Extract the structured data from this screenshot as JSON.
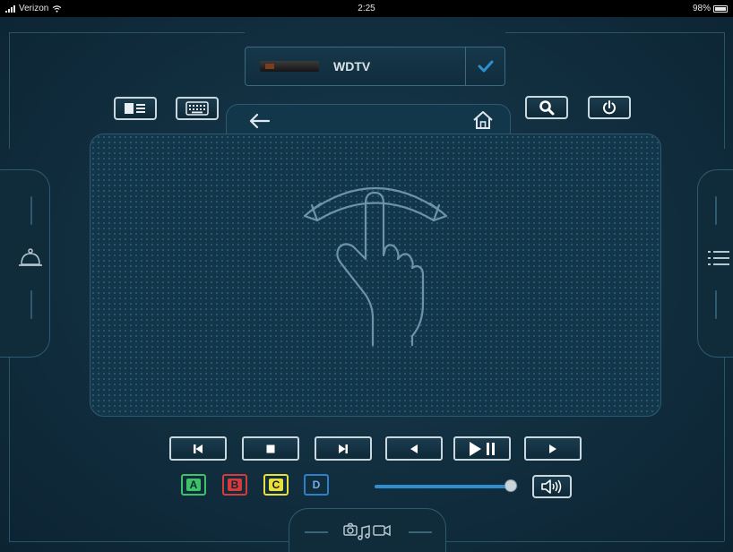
{
  "status_bar": {
    "carrier": "Verizon",
    "time": "2:25",
    "battery": "98%"
  },
  "device_selector": {
    "name": "WDTV"
  },
  "top_buttons": [
    {
      "name": "library-view-button",
      "icon": "panel-list-icon"
    },
    {
      "name": "keyboard-button",
      "icon": "keyboard-icon"
    },
    {
      "name": "search-button",
      "icon": "search-icon"
    },
    {
      "name": "power-button",
      "icon": "power-icon"
    }
  ],
  "touchpad": {
    "back_icon": "arrow-left-icon",
    "home_icon": "home-icon",
    "gesture_icon": "swipe-hand-icon"
  },
  "side": {
    "left_icon": "bell-icon",
    "right_icon": "list-icon"
  },
  "transport": [
    {
      "name": "previous-track-button",
      "icon": "skip-previous-icon"
    },
    {
      "name": "stop-button",
      "icon": "stop-icon"
    },
    {
      "name": "next-track-button",
      "icon": "skip-next-icon"
    },
    {
      "name": "rewind-button",
      "icon": "rewind-icon"
    },
    {
      "name": "play-pause-button",
      "icon": "play-pause-icon"
    },
    {
      "name": "forward-button",
      "icon": "forward-icon"
    }
  ],
  "color_keys": [
    {
      "label": "A",
      "color": "#3ec265"
    },
    {
      "label": "B",
      "color": "#d63a3a"
    },
    {
      "label": "C",
      "color": "#e8df3a"
    },
    {
      "label": "D",
      "color": "#2f7fc8"
    }
  ],
  "volume": {
    "level": 0.95,
    "icon": "speaker-icon"
  },
  "bottom": {
    "icon": "media-sources-icon"
  },
  "colors": {
    "accent": "#2d8fd0",
    "background": "#123041",
    "button_border": "#c9d7df"
  }
}
